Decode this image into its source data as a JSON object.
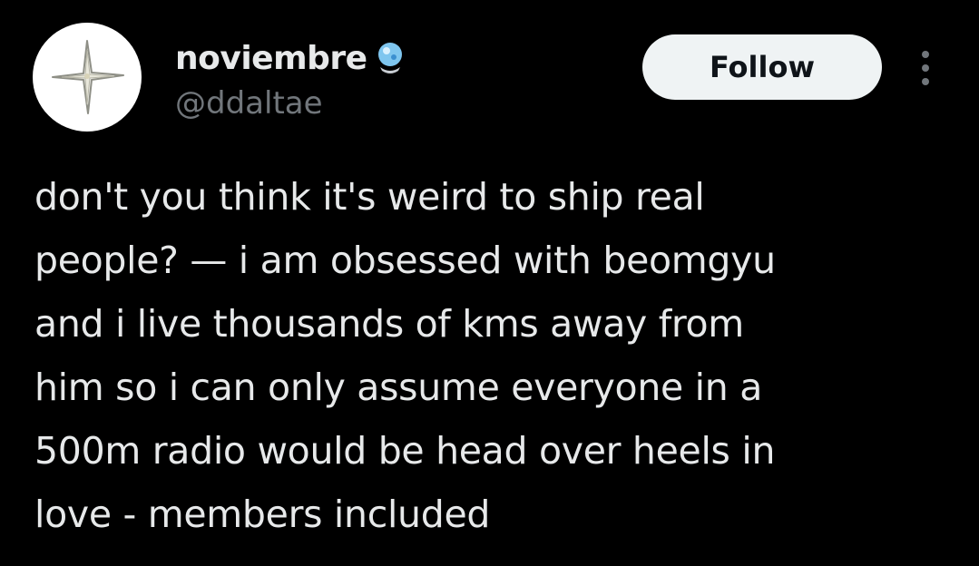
{
  "author": {
    "display_name": "noviembre",
    "handle": "@ddaltae",
    "avatar_icon": "four-point-star-icon",
    "name_emoji_icon": "crystal-ball-emoji-icon"
  },
  "actions": {
    "follow_label": "Follow",
    "more_icon": "more-vertical-icon"
  },
  "tweet": {
    "lines": [
      "don't you think it's weird to ship real",
      "people? — i am obsessed with beomgyu",
      "and i live thousands of kms away from",
      "him so i can only assume everyone in a",
      "500m radio would be head over heels in",
      "love - members included"
    ]
  },
  "colors": {
    "background": "#000000",
    "primary_text": "#e7e9ea",
    "secondary_text": "#71767b",
    "follow_bg": "#eff3f4",
    "follow_text": "#0f1419"
  }
}
